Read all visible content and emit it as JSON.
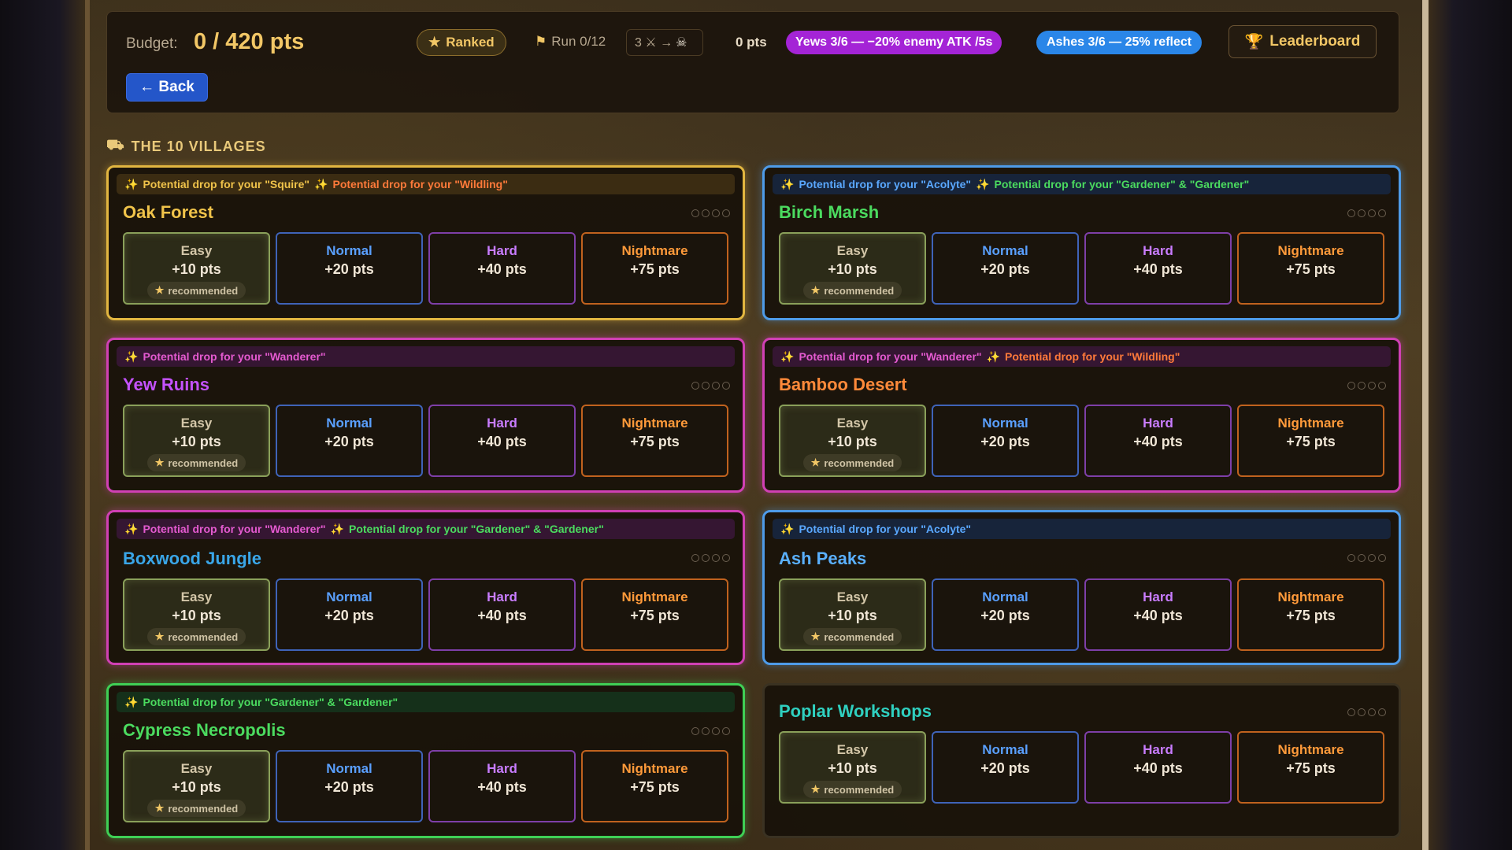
{
  "header": {
    "budget_label": "Budget:",
    "budget_value": "0 / 420 pts",
    "ranked_label": "Ranked",
    "run_label": "Run 0/12",
    "combo_text": "3 ⚔ →",
    "pts_label": "0 pts",
    "yews_pill": "Yews 3/6 — −20% enemy ATK /5s",
    "ashes_pill": "Ashes 3/6 — 25% reflect",
    "leaderboard_label": "Leaderboard",
    "back_label": "← Back"
  },
  "section_title": "THE 10 VILLAGES",
  "difficulty_labels": {
    "easy": "Easy",
    "normal": "Normal",
    "hard": "Hard",
    "nightmare": "Nightmare",
    "easy_pts": "+10 pts",
    "normal_pts": "+20 pts",
    "hard_pts": "+40 pts",
    "nightmare_pts": "+75 pts",
    "recommended": "recommended"
  },
  "villages": [
    {
      "name": "Oak Forest",
      "drops": [
        "Potential drop for your \"Squire\"",
        "Potential drop for your \"Wildling\""
      ]
    },
    {
      "name": "Birch Marsh",
      "drops": [
        "Potential drop for your \"Acolyte\"",
        "Potential drop for your \"Gardener\" & \"Gardener\""
      ]
    },
    {
      "name": "Yew Ruins",
      "drops": [
        "Potential drop for your \"Wanderer\""
      ]
    },
    {
      "name": "Bamboo Desert",
      "drops": [
        "Potential drop for your \"Wanderer\"",
        "Potential drop for your \"Wildling\""
      ]
    },
    {
      "name": "Boxwood Jungle",
      "drops": [
        "Potential drop for your \"Wanderer\"",
        "Potential drop for your \"Gardener\" & \"Gardener\""
      ]
    },
    {
      "name": "Ash Peaks",
      "drops": [
        "Potential drop for your \"Acolyte\""
      ]
    },
    {
      "name": "Cypress Necropolis",
      "drops": [
        "Potential drop for your \"Gardener\" & \"Gardener\""
      ]
    },
    {
      "name": "Poplar Workshops",
      "drops": []
    }
  ],
  "colors": {
    "budget": "#f2c766",
    "yews_pill": "#a424d6",
    "ashes_pill": "#2a86e8",
    "back_button": "#2456c9",
    "normal": "#5aa0ff",
    "hard": "#c87cff",
    "nightmare": "#ff9a3a"
  }
}
